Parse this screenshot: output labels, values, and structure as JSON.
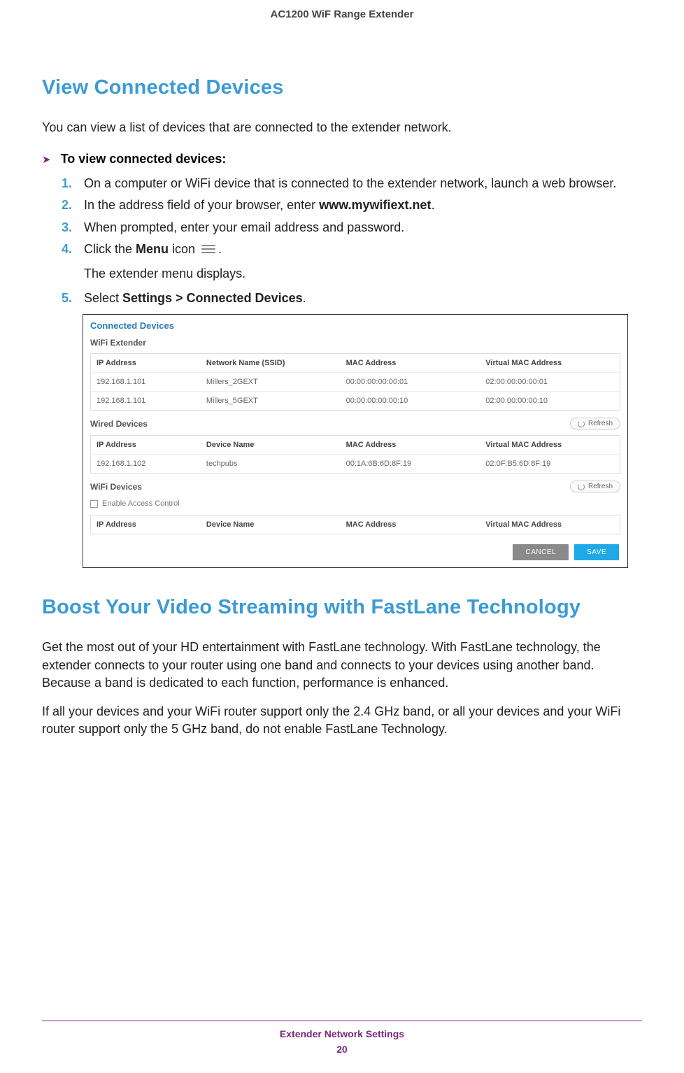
{
  "header_title": "AC1200 WiF Range Extender",
  "section1_title": "View Connected Devices",
  "section1_intro": "You can view a list of devices that are connected to the extender network.",
  "proc_heading": "To view connected devices:",
  "steps": {
    "s1": "On a computer or WiFi device that is connected to the extender network, launch a web browser.",
    "s2_pre": "In the address field of your browser, enter ",
    "s2_bold": "www.mywifiext.net",
    "s2_post": ".",
    "s3": "When prompted, enter your email address and password.",
    "s4_pre": "Click the ",
    "s4_bold": "Menu",
    "s4_mid": " icon ",
    "s4_post": ".",
    "s4_sub": "The extender menu displays.",
    "s5_pre": "Select ",
    "s5_bold": "Settings > Connected Devices",
    "s5_post": "."
  },
  "panel": {
    "title": "Connected Devices",
    "wifi_ext_label": "WiFi Extender",
    "headers": {
      "ip": "IP Address",
      "ssid": "Network Name (SSID)",
      "mac": "MAC Address",
      "vmac": "Virtual MAC Address",
      "devname": "Device Name"
    },
    "wifi_ext_rows": [
      {
        "ip": "192.168.1.101",
        "ssid": "Millers_2GEXT",
        "mac": "00:00:00:00:00:01",
        "vmac": "02:00:00:00:00:01"
      },
      {
        "ip": "192.168.1.101",
        "ssid": "Millers_5GEXT",
        "mac": "00:00:00:00:00:10",
        "vmac": "02:00:00:00:00:10"
      }
    ],
    "wired_label": "Wired Devices",
    "refresh_label": "Refresh",
    "wired_rows": [
      {
        "ip": "192.168.1.102",
        "name": "techpubs",
        "mac": "00:1A:6B:6D:8F:19",
        "vmac": "02:0F:B5:6D:8F:19"
      }
    ],
    "wifi_dev_label": "WiFi Devices",
    "access_control_label": "Enable Access Control",
    "cancel_label": "CANCEL",
    "save_label": "SAVE"
  },
  "section2_title": "Boost Your Video Streaming with FastLane Technology",
  "section2_p1": "Get the most out of your HD entertainment with FastLane technology. With FastLane technology, the extender connects to your router using one band and connects to your devices using another band. Because a band is dedicated to each function, performance is enhanced.",
  "section2_p2": "If all your devices and your WiFi router support only the 2.4 GHz band, or all your devices and your WiFi router support only the 5 GHz band, do not enable FastLane Technology.",
  "footer_section": "Extender Network Settings",
  "footer_page": "20"
}
